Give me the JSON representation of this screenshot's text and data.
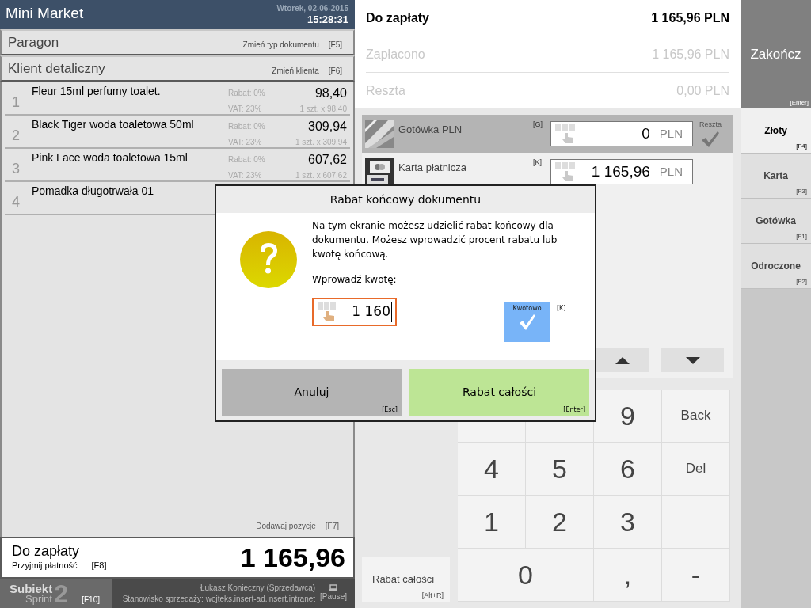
{
  "header": {
    "title": "Mini Market",
    "date": "Wtorek, 02-06-2015",
    "time": "15:28:31"
  },
  "document": {
    "type": "Paragon",
    "action": "Zmień typ dokumentu",
    "key": "[F5]"
  },
  "customer": {
    "name": "Klient detaliczny",
    "action": "Zmień klienta",
    "key": "[F6]"
  },
  "items": [
    {
      "no": "1",
      "name": "Fleur 15ml perfumy toalet.",
      "discount": "Rabat:  0%",
      "vat": "VAT:  23%",
      "total": "98,40",
      "qty": "1 szt. x 98,40"
    },
    {
      "no": "2",
      "name": "Black Tiger woda toaletowa 50ml",
      "discount": "Rabat:  0%",
      "vat": "VAT:  23%",
      "total": "309,94",
      "qty": "1 szt. x 309,94"
    },
    {
      "no": "3",
      "name": "Pink Lace woda toaletowa 15ml",
      "discount": "Rabat:  0%",
      "vat": "VAT:  23%",
      "total": "607,62",
      "qty": "1 szt. x 607,62"
    },
    {
      "no": "4",
      "name": "Pomadka długotrwała 01"
    }
  ],
  "add_items": {
    "label": "Dodawaj pozycje",
    "key": "[F7]"
  },
  "total_panel": {
    "label": "Do zapłaty",
    "action": "Przyjmij płatność",
    "key": "[F8]",
    "amount": "1 165,96"
  },
  "footer": {
    "logo_top": "Subiekt",
    "logo_bottom": "Sprint",
    "logo_number": "2",
    "logo_key": "[F10]",
    "user": "Łukasz Konieczny (Sprzedawca)",
    "station": "Stanowisko sprzedaży: wojteks.insert-ad.insert.intranet",
    "lock_key": "[Pause]"
  },
  "summary": [
    {
      "label": "Do zapłaty",
      "value": "1 165,96 PLN",
      "emphasis": true
    },
    {
      "label": "Zapłacono",
      "value": "1 165,96 PLN",
      "emphasis": false
    },
    {
      "label": "Reszta",
      "value": "0,00 PLN",
      "emphasis": false
    }
  ],
  "finish_button": {
    "label": "Zakończ",
    "key": "[Enter]"
  },
  "payments": [
    {
      "kind": "cash",
      "name": "Gotówka PLN",
      "key": "[G]",
      "value": "0",
      "currency": "PLN",
      "selected": true,
      "change_label": "Reszta"
    },
    {
      "kind": "card",
      "name": "Karta płatnicza",
      "key": "[K]",
      "value": "1 165,96",
      "currency": "PLN",
      "selected": false
    }
  ],
  "side_tabs": [
    {
      "label": "Złoty",
      "key": "[F4]",
      "selected": true
    },
    {
      "label": "Karta",
      "key": "[F3]",
      "selected": false
    },
    {
      "label": "Gotówka",
      "key": "[F1]",
      "selected": false
    },
    {
      "label": "Odroczone",
      "key": "[F2]",
      "selected": false
    }
  ],
  "discount_button": {
    "label": "Rabat całości",
    "key": "[Alt+R]"
  },
  "keypad": [
    {
      "kind": "blank"
    },
    {
      "kind": "blank"
    },
    {
      "kind": "key",
      "label": "9"
    },
    {
      "kind": "key",
      "label": "Back"
    },
    {
      "kind": "key",
      "label": "4"
    },
    {
      "kind": "key",
      "label": "5"
    },
    {
      "kind": "key",
      "label": "6"
    },
    {
      "kind": "key",
      "label": "Del"
    },
    {
      "kind": "key",
      "label": "1"
    },
    {
      "kind": "key",
      "label": "2"
    },
    {
      "kind": "key",
      "label": "3"
    },
    {
      "kind": "blank"
    },
    {
      "kind": "wide",
      "label": "0"
    },
    {
      "kind": "key",
      "label": ","
    },
    {
      "kind": "key",
      "label": "-"
    }
  ],
  "dialog": {
    "title": "Rabat końcowy dokumentu",
    "message": "Na tym ekranie możesz udzielić rabat końcowy dla dokumentu. Możesz wprowadzić procent rabatu lub kwotę końcową.",
    "prompt": "Wprowadź kwotę:",
    "value": "1 160",
    "toggle": {
      "label": "Kwotowo",
      "checked": true,
      "key": "[K]"
    },
    "buttons": [
      {
        "kind": "cancel",
        "label": "Anuluj",
        "key": "[Esc]"
      },
      {
        "kind": "confirm",
        "label": "Rabat całości",
        "key": "[Enter]"
      }
    ]
  }
}
